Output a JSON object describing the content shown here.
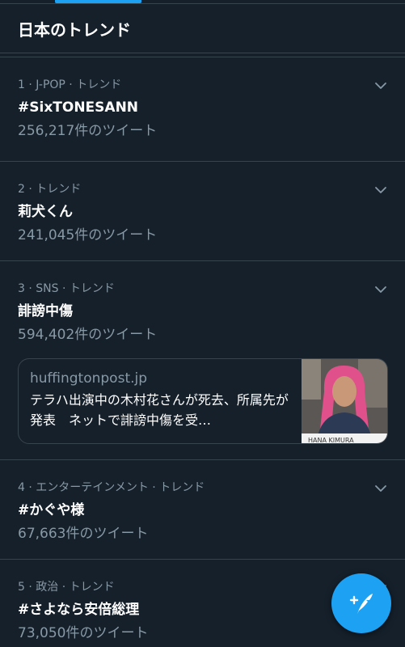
{
  "header": {
    "title": "日本のトレンド"
  },
  "trends": [
    {
      "meta": "1 · J-POP · トレンド",
      "name": "#SixTONESANN",
      "count": "256,217件のツイート"
    },
    {
      "meta": "2 · トレンド",
      "name": "莉犬くん",
      "count": "241,045件のツイート"
    },
    {
      "meta": "3 · SNS · トレンド",
      "name": "誹謗中傷",
      "count": "594,402件のツイート",
      "card": {
        "domain": "huffingtonpost.jp",
        "title": "テラハ出演中の木村花さんが死去、所属先が発表　ネットで誹謗中傷を受…",
        "thumb_caption": "HANA KIMURA"
      }
    },
    {
      "meta": "4 · エンターテインメント · トレンド",
      "name": "#かぐや様",
      "count": "67,663件のツイート"
    },
    {
      "meta": "5 · 政治 · トレンド",
      "name": "#さよなら安倍総理",
      "count": "73,050件のツイート"
    }
  ],
  "colors": {
    "background": "#15202b",
    "accent": "#1da1f2",
    "secondary_text": "#8899a6",
    "divider": "#38444d"
  },
  "icons": {
    "chevron": "chevron-down-icon",
    "compose": "compose-tweet-icon"
  }
}
